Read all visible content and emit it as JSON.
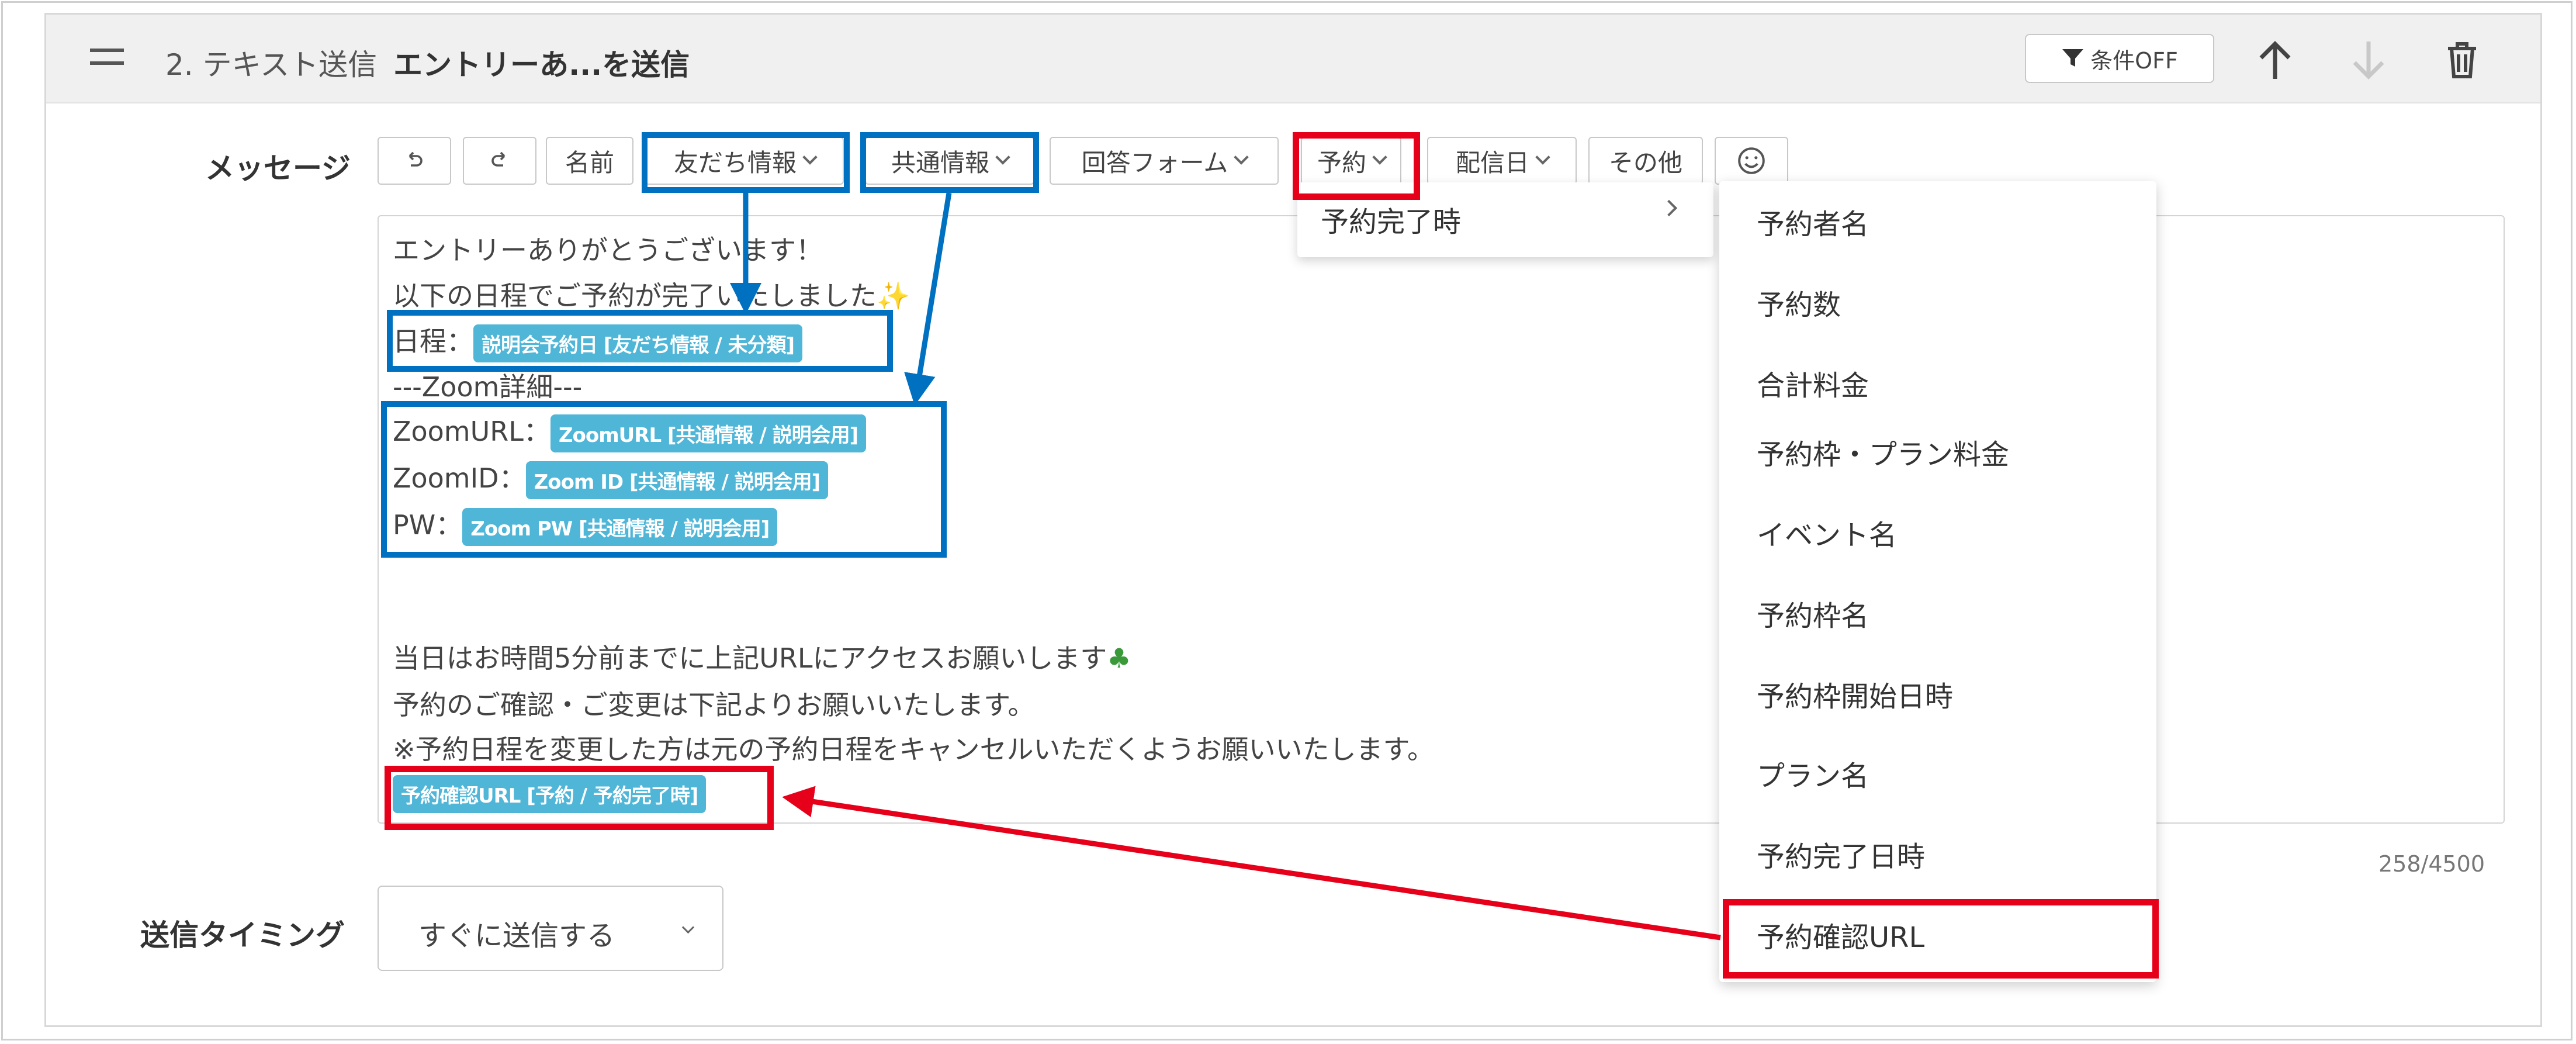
{
  "header": {
    "step_number": "2. テキスト送信",
    "step_name": "エントリーあ...を送信",
    "condition_button": "条件OFF"
  },
  "message": {
    "label": "メッセージ",
    "toolbar": {
      "name": "名前",
      "friend_info": "友だち情報",
      "common_info": "共通情報",
      "answer_form": "回答フォーム",
      "reservation": "予約",
      "delivery_date": "配信日",
      "other": "その他"
    },
    "body": {
      "line1": "エントリーありがとうございます！",
      "line2": "以下の日程でご予約が完了いたしました",
      "line3_prefix": "日程：",
      "line3_tag": "説明会予約日 [友だち情報 / 未分類]",
      "line4": "---Zoom詳細---",
      "line5_prefix": "ZoomURL：",
      "line5_tag": "ZoomURL [共通情報 / 説明会用]",
      "line6_prefix": "ZoomID：",
      "line6_tag": "Zoom ID [共通情報 / 説明会用]",
      "line7_prefix": "PW：",
      "line7_tag": "Zoom PW [共通情報 / 説明会用]",
      "line8": "当日はお時間5分前までに上記URLにアクセスお願いします",
      "line9": "予約のご確認・ご変更は下記よりお願いいたします。",
      "line10": "※予約日程を変更した方は元の予約日程をキャンセルいただくようお願いいたします。",
      "line11_tag": "予約確認URL [予約 / 予約完了時]"
    },
    "char_count": "258/4500"
  },
  "timing": {
    "label": "送信タイミング",
    "value": "すぐに送信する"
  },
  "reservation_submenu": {
    "item": "予約完了時"
  },
  "reservation_fields": [
    "予約者名",
    "予約数",
    "合計料金",
    "予約枠・プラン料金",
    "イベント名",
    "予約枠名",
    "予約枠開始日時",
    "プラン名",
    "予約完了日時",
    "予約確認URL"
  ],
  "colors": {
    "tag": "#4fb6d8",
    "annotation_blue": "#0070c0",
    "annotation_red": "#e6001a",
    "header_bg": "#f0f0f0"
  }
}
